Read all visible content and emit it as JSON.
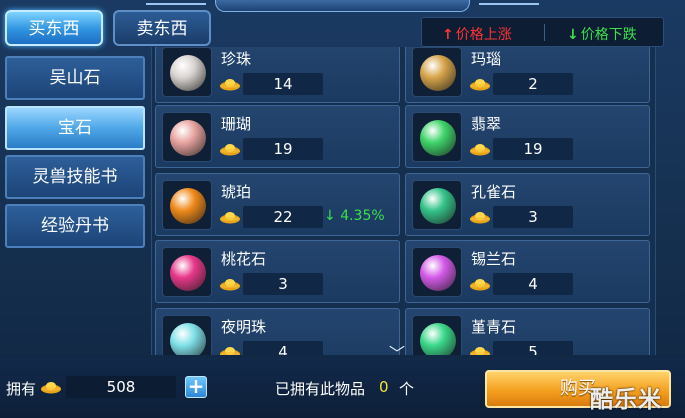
{
  "tabs": {
    "buy": "买东西",
    "sell": "卖东西"
  },
  "legend": {
    "up": "价格上涨",
    "down": "价格下跌"
  },
  "categories": [
    {
      "label": "吴山石",
      "active": false
    },
    {
      "label": "宝石",
      "active": true
    },
    {
      "label": "灵兽技能书",
      "active": false
    },
    {
      "label": "经验丹书",
      "active": false
    }
  ],
  "items": [
    {
      "name": "珍珠",
      "price": "14",
      "gem_color": "#d9d3d0",
      "trend": ""
    },
    {
      "name": "玛瑙",
      "price": "2",
      "gem_color": "#d6a44a",
      "trend": ""
    },
    {
      "name": "珊瑚",
      "price": "19",
      "gem_color": "#e8a4a0",
      "trend": ""
    },
    {
      "name": "翡翠",
      "price": "19",
      "gem_color": "#3fd46a",
      "trend": ""
    },
    {
      "name": "琥珀",
      "price": "22",
      "gem_color": "#f08a1a",
      "trend": "4.35%"
    },
    {
      "name": "孔雀石",
      "price": "3",
      "gem_color": "#35c48a",
      "trend": ""
    },
    {
      "name": "桃花石",
      "price": "3",
      "gem_color": "#e8388a",
      "trend": ""
    },
    {
      "name": "锡兰石",
      "price": "4",
      "gem_color": "#d45ae8",
      "trend": ""
    },
    {
      "name": "夜明珠",
      "price": "4",
      "gem_color": "#7fe0e8",
      "trend": ""
    },
    {
      "name": "堇青石",
      "price": "5",
      "gem_color": "#3ad88a",
      "trend": ""
    }
  ],
  "footer": {
    "own_label": "拥有",
    "own_value": "508",
    "owned_label": "已拥有此物品",
    "owned_count": "0",
    "owned_unit": "个",
    "buy_label": "购买"
  },
  "watermark": "酷乐米",
  "icons": {
    "up": "arrow-up-icon",
    "down": "arrow-down-icon",
    "currency": "gold-ingot-icon",
    "add": "plus-icon",
    "scroll": "chevron-down-icon"
  }
}
